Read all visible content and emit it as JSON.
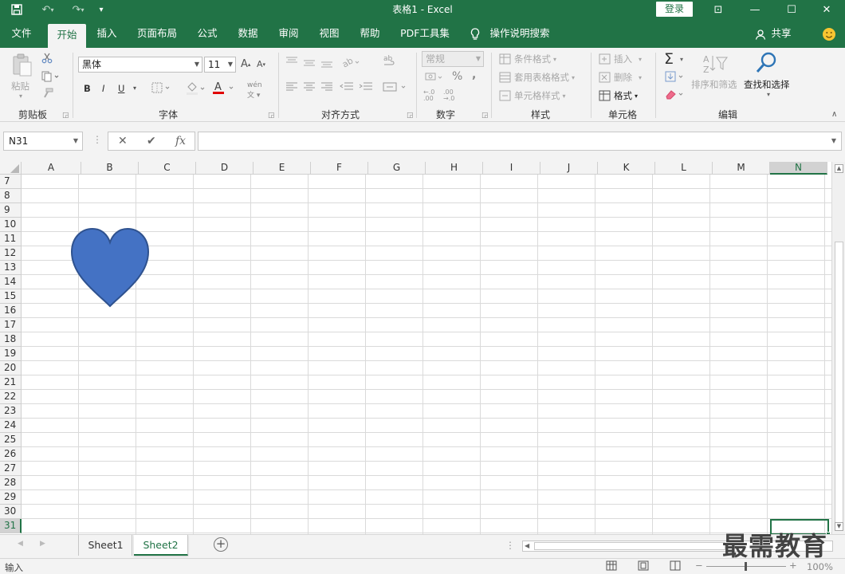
{
  "window": {
    "title": "表格1  -  Excel",
    "login_label": "登录",
    "minimize": "—",
    "maximize": "☐",
    "close": "✕",
    "restore_ribbon": "⊡"
  },
  "menu_tabs": [
    {
      "label": "文件"
    },
    {
      "label": "开始",
      "active": true
    },
    {
      "label": "插入"
    },
    {
      "label": "页面布局"
    },
    {
      "label": "公式"
    },
    {
      "label": "数据"
    },
    {
      "label": "审阅"
    },
    {
      "label": "视图"
    },
    {
      "label": "帮助"
    },
    {
      "label": "PDF工具集"
    },
    {
      "label": "操作说明搜索"
    }
  ],
  "share_label": "共享",
  "ribbon": {
    "clipboard": {
      "label": "剪贴板",
      "paste": "粘贴"
    },
    "font": {
      "label": "字体",
      "font_name": "黑体",
      "font_size": "11",
      "bold": "B",
      "italic": "I",
      "underline": "U"
    },
    "alignment": {
      "label": "对齐方式"
    },
    "number": {
      "label": "数字",
      "format": "常规",
      "percent": "%",
      "comma": ","
    },
    "styles": {
      "label": "样式",
      "cond_format": "条件格式",
      "table_format": "套用表格格式",
      "cell_style": "单元格样式"
    },
    "cells": {
      "label": "单元格",
      "insert": "插入",
      "delete": "删除",
      "format": "格式"
    },
    "editing": {
      "label": "编辑",
      "sort_filter": "排序和筛选",
      "find_select": "查找和选择",
      "sigma": "Σ"
    }
  },
  "formula_bar": {
    "name_box": "N31",
    "cancel": "✕",
    "enter": "✔",
    "fx": "fx",
    "value": ""
  },
  "columns": [
    "A",
    "B",
    "C",
    "D",
    "E",
    "F",
    "G",
    "H",
    "I",
    "J",
    "K",
    "L",
    "M",
    "N"
  ],
  "selected_column": "N",
  "rows": [
    "7",
    "8",
    "9",
    "10",
    "11",
    "12",
    "13",
    "14",
    "15",
    "16",
    "17",
    "18",
    "19",
    "20",
    "21",
    "22",
    "23",
    "24",
    "25",
    "26",
    "27",
    "28",
    "29",
    "30",
    "31"
  ],
  "selected_row": "31",
  "shape": {
    "type": "heart",
    "fill": "#4472c4",
    "stroke": "#2f528f"
  },
  "sheets": [
    {
      "label": "Sheet1"
    },
    {
      "label": "Sheet2",
      "active": true
    }
  ],
  "add_sheet": "+",
  "status": {
    "mode": "输入",
    "zoom": "100%"
  },
  "watermark": "最需教育",
  "colors": {
    "accent": "#217346",
    "ribbon_bg": "#f3f3f3"
  }
}
